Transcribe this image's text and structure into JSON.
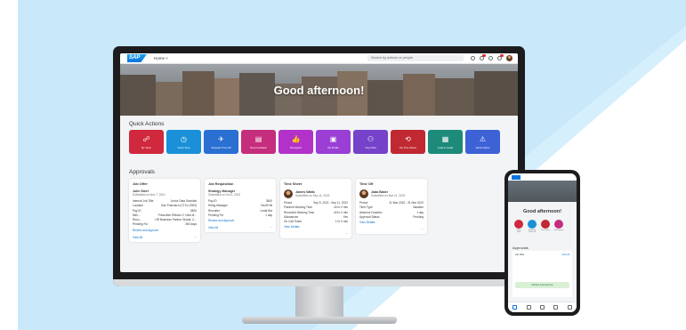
{
  "shell": {
    "logo": "SAP",
    "home": "Home ˅",
    "search_placeholder": "Search by actions or people"
  },
  "hero": {
    "greeting": "Good afternoon!"
  },
  "quick_actions": {
    "title": "Quick Actions",
    "items": [
      {
        "label": "My Team",
        "icon": "team-icon",
        "glyph": "☍",
        "color": "#d0283c"
      },
      {
        "label": "Clock Time",
        "icon": "clock-icon",
        "glyph": "◷",
        "color": "#1b90d8"
      },
      {
        "label": "Request Time Off",
        "icon": "plane-icon",
        "glyph": "✈",
        "color": "#2a6fd2"
      },
      {
        "label": "New Feedback",
        "icon": "feedback-icon",
        "glyph": "▤",
        "color": "#c52e7c"
      },
      {
        "label": "Recognize",
        "icon": "thumbs-up-icon",
        "glyph": "👍",
        "color": "#b232c9"
      },
      {
        "label": "My Profile",
        "icon": "profile-icon",
        "glyph": "▣",
        "color": "#9a3ed6"
      },
      {
        "label": "Org Chart",
        "icon": "org-chart-icon",
        "glyph": "⚇",
        "color": "#7542c9"
      },
      {
        "label": "My Time Sheet",
        "icon": "timesheet-icon",
        "glyph": "⟲",
        "color": "#c02932"
      },
      {
        "label": "Lead to Goals",
        "icon": "goals-icon",
        "glyph": "▦",
        "color": "#1d8a7a"
      },
      {
        "label": "Admin Alerts",
        "icon": "alert-icon",
        "glyph": "⚠",
        "color": "#3d62d6"
      }
    ]
  },
  "approvals": {
    "title": "Approvals",
    "cards": [
      {
        "title": "Job Offer",
        "name": "Julie Steel",
        "sub": "Submitted on Nov 7, 2021",
        "rows": [
          [
            "Internal Job Title",
            "Junior Data Scientist"
          ],
          [
            "Location",
            "San Francisco (CTLU-2300)"
          ],
          [
            "Pay ID",
            "3500"
          ],
          [
            "Mini...",
            "Prescriber Effector 2, New M..."
          ],
          [
            "Reco...",
            "HR Business Partner Global, C..."
          ],
          [
            "Pending For",
            "260 days"
          ]
        ],
        "link": "Review and Approve",
        "foot_link": "View All",
        "more": "···"
      },
      {
        "title": "Job Requisition",
        "name": "Strategy Manager",
        "sub": "Submitted on Oct 4, 2022",
        "rows": [
          [
            "Pay ID",
            "3500"
          ],
          [
            "Hiring Manager",
            "Geoff Hill"
          ],
          [
            "Recruiter",
            "Linda Bot"
          ],
          [
            "Pending For",
            "1 day"
          ]
        ],
        "link": "Review and Approve",
        "foot_link": "View All",
        "more": "···"
      },
      {
        "title": "Time Sheet",
        "name": "James Watts",
        "sub": "Submitted on Sep 11, 2022",
        "rows": [
          [
            "Period",
            "Sep 5, 2022 - Sep 11, 2022"
          ],
          [
            "Planned Working Time",
            "40 hr 0 min"
          ],
          [
            "Recorded Working Time",
            "40 hr 0 min"
          ],
          [
            "Allowances",
            "Yes"
          ],
          [
            "On Call Times",
            "1 hr 0 min"
          ]
        ],
        "link": "View Details",
        "foot_link": "",
        "more": "···"
      },
      {
        "title": "Time Off",
        "name": "Jada Baker",
        "sub": "Submitted on Mar 21, 2022",
        "rows": [
          [
            "Period",
            "31 Mar 2022 - 31 Mar 2022"
          ],
          [
            "Time Type",
            "Vacation"
          ],
          [
            "Absence Duration",
            "1 day"
          ],
          [
            "Approval Status",
            "Pending"
          ]
        ],
        "link": "View Details",
        "foot_link": "",
        "more": "···"
      }
    ]
  },
  "phone": {
    "greeting": "Good afternoon!",
    "qa_labels": [
      "Clock Time",
      "Request Time Off",
      "Set Goals",
      "Recognize"
    ],
    "approvals": "Approvals",
    "card_title": "Job Offer",
    "card_link": "View All",
    "button": "Review and Approve"
  }
}
